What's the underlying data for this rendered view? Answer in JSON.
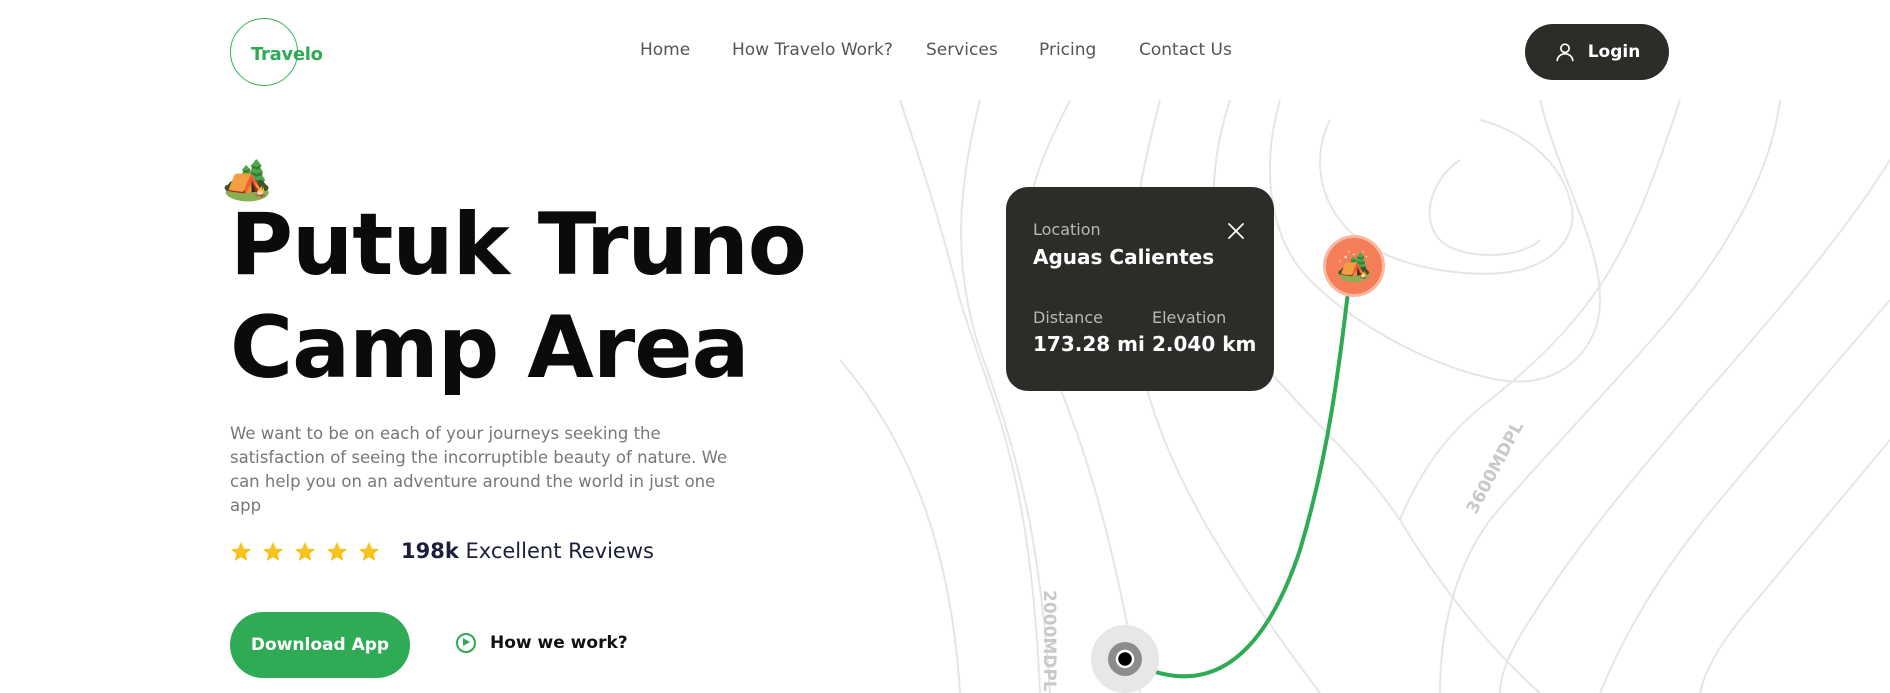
{
  "header": {
    "logo_text": "Travelo",
    "nav": [
      "Home",
      "How Travelo Work?",
      "Services",
      "Pricing",
      "Contact Us"
    ],
    "login_label": "Login"
  },
  "hero": {
    "emoji": "🏕️",
    "title_line1": "Putuk Truno",
    "title_line2": "Camp Area",
    "description": "We want to be on each of your journeys seeking the satisfaction of seeing the incorruptible beauty of nature. We can help you on an adventure around the world in just one app",
    "rating": {
      "stars": 5,
      "count": "198k",
      "label": "Excellent Reviews"
    },
    "download_label": "Download App",
    "how_label": "How we work?"
  },
  "map": {
    "card": {
      "location_label": "Location",
      "location_value": "Aguas Calientes",
      "distance_label": "Distance",
      "distance_value": "173.28 mi",
      "elevation_label": "Elevation",
      "elevation_value": "2.040 km"
    },
    "contour_labels": [
      "3600MDPL",
      "2000MDPL"
    ],
    "pin_emoji": "🏕️",
    "route_color": "#2faa55",
    "pin_color": "#f37e57"
  },
  "colors": {
    "accent": "#2faa55",
    "dark": "#2b2d29",
    "star": "#f7c21b"
  }
}
